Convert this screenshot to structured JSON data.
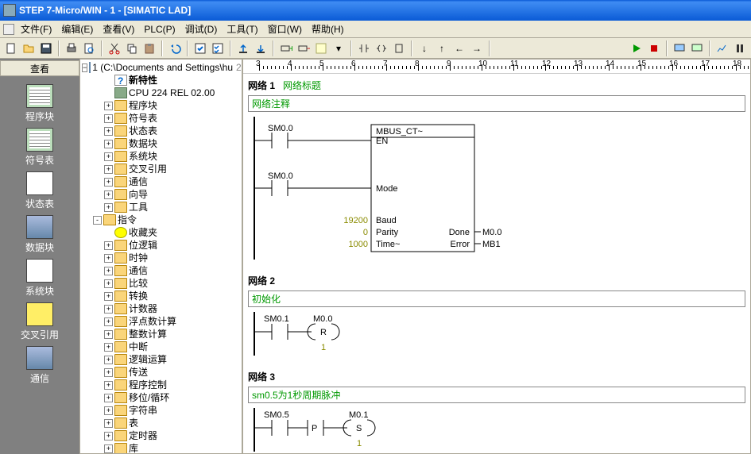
{
  "title": "STEP 7-Micro/WIN - 1 - [SIMATIC LAD]",
  "menu": [
    "文件(F)",
    "编辑(E)",
    "查看(V)",
    "PLC(P)",
    "调试(D)",
    "工具(T)",
    "窗口(W)",
    "帮助(H)"
  ],
  "nav_header": "查看",
  "nav_items": [
    {
      "label": "程序块",
      "icon": "grid"
    },
    {
      "label": "符号表",
      "icon": "grid"
    },
    {
      "label": "状态表",
      "icon": "tab"
    },
    {
      "label": "数据块",
      "icon": "db"
    },
    {
      "label": "系统块",
      "icon": "tab"
    },
    {
      "label": "交叉引用",
      "icon": "yellow"
    },
    {
      "label": "通信",
      "icon": "db"
    }
  ],
  "tree": {
    "root": "1 (C:\\Documents and Settings\\hu",
    "root_page": "2",
    "items": [
      {
        "lvl": 2,
        "exp": null,
        "icon": "q",
        "label": "新特性",
        "bold": true
      },
      {
        "lvl": 2,
        "exp": null,
        "icon": "chip",
        "label": "CPU 224 REL 02.00"
      },
      {
        "lvl": 2,
        "exp": "+",
        "icon": "folder",
        "label": "程序块"
      },
      {
        "lvl": 2,
        "exp": "+",
        "icon": "folder",
        "label": "符号表"
      },
      {
        "lvl": 2,
        "exp": "+",
        "icon": "folder",
        "label": "状态表"
      },
      {
        "lvl": 2,
        "exp": "+",
        "icon": "folder",
        "label": "数据块"
      },
      {
        "lvl": 2,
        "exp": "+",
        "icon": "folder",
        "label": "系统块"
      },
      {
        "lvl": 2,
        "exp": "+",
        "icon": "folder",
        "label": "交叉引用"
      },
      {
        "lvl": 2,
        "exp": "+",
        "icon": "folder",
        "label": "通信"
      },
      {
        "lvl": 2,
        "exp": "+",
        "icon": "folder",
        "label": "向导"
      },
      {
        "lvl": 2,
        "exp": "+",
        "icon": "folder",
        "label": "工具"
      },
      {
        "lvl": 1,
        "exp": "-",
        "icon": "folder",
        "label": "指令"
      },
      {
        "lvl": 2,
        "exp": null,
        "icon": "star",
        "label": "收藏夹"
      },
      {
        "lvl": 2,
        "exp": "+",
        "icon": "folder",
        "label": "位逻辑"
      },
      {
        "lvl": 2,
        "exp": "+",
        "icon": "folder",
        "label": "时钟"
      },
      {
        "lvl": 2,
        "exp": "+",
        "icon": "folder",
        "label": "通信"
      },
      {
        "lvl": 2,
        "exp": "+",
        "icon": "folder",
        "label": "比较"
      },
      {
        "lvl": 2,
        "exp": "+",
        "icon": "folder",
        "label": "转换"
      },
      {
        "lvl": 2,
        "exp": "+",
        "icon": "folder",
        "label": "计数器"
      },
      {
        "lvl": 2,
        "exp": "+",
        "icon": "folder",
        "label": "浮点数计算"
      },
      {
        "lvl": 2,
        "exp": "+",
        "icon": "folder",
        "label": "整数计算"
      },
      {
        "lvl": 2,
        "exp": "+",
        "icon": "folder",
        "label": "中断"
      },
      {
        "lvl": 2,
        "exp": "+",
        "icon": "folder",
        "label": "逻辑运算"
      },
      {
        "lvl": 2,
        "exp": "+",
        "icon": "folder",
        "label": "传送"
      },
      {
        "lvl": 2,
        "exp": "+",
        "icon": "folder",
        "label": "程序控制"
      },
      {
        "lvl": 2,
        "exp": "+",
        "icon": "folder",
        "label": "移位/循环"
      },
      {
        "lvl": 2,
        "exp": "+",
        "icon": "folder",
        "label": "字符串"
      },
      {
        "lvl": 2,
        "exp": "+",
        "icon": "folder",
        "label": "表"
      },
      {
        "lvl": 2,
        "exp": "+",
        "icon": "folder",
        "label": "定时器"
      },
      {
        "lvl": 2,
        "exp": "+",
        "icon": "folder",
        "label": "库"
      }
    ]
  },
  "ruler_marks": [
    3,
    4,
    5,
    6,
    7,
    8,
    9,
    10,
    11,
    12,
    13,
    14,
    15,
    16,
    17,
    18
  ],
  "networks": [
    {
      "n": 1,
      "header": "网络  1",
      "title": "网络标题",
      "comment": "网络注释",
      "type": "fb",
      "contacts": [
        {
          "addr": "SM0.0",
          "y": 0
        },
        {
          "addr": "SM0.0",
          "y": 60
        }
      ],
      "block": {
        "name": "MBUS_CT~",
        "left": [
          {
            "label": "EN",
            "val": null
          },
          {
            "label": "Mode",
            "val": null
          },
          {
            "label": "Baud",
            "val": "19200"
          },
          {
            "label": "Parity",
            "val": "0"
          },
          {
            "label": "Time~",
            "val": "1000"
          }
        ],
        "right": [
          {
            "label": "Done",
            "val": "M0.0",
            "row": 3
          },
          {
            "label": "Error",
            "val": "MB1",
            "row": 4
          }
        ]
      }
    },
    {
      "n": 2,
      "header": "网络  2",
      "comment": "初始化",
      "type": "coil",
      "contact": "SM0.1",
      "coil": {
        "addr": "M0.0",
        "op": "R",
        "param": "1"
      }
    },
    {
      "n": 3,
      "header": "网络  3",
      "comment": "sm0.5为1秒周期脉冲",
      "type": "coil",
      "contact": "SM0.5",
      "mid_op": "P",
      "coil": {
        "addr": "M0.1",
        "op": "S",
        "param": "1"
      }
    }
  ]
}
